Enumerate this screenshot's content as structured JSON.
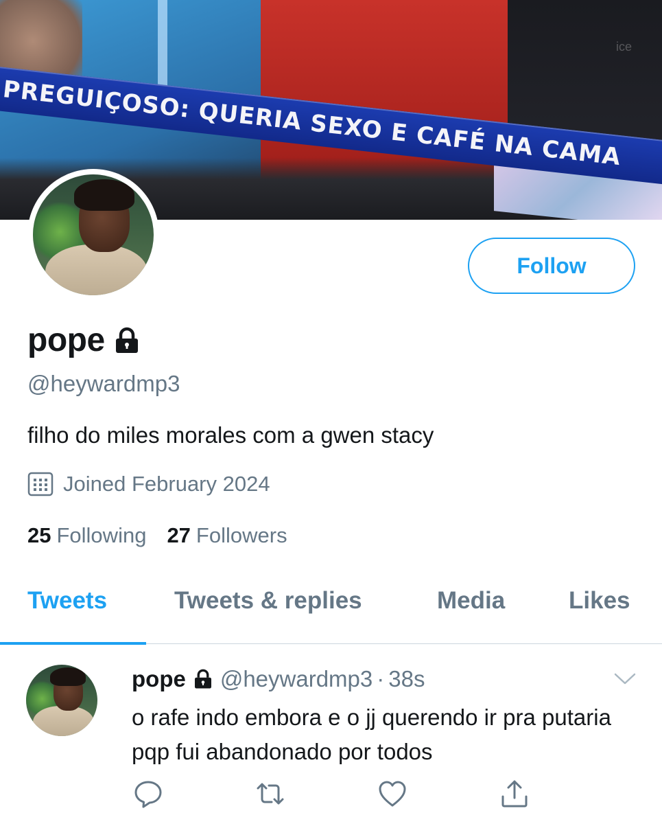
{
  "banner": {
    "ticker_text": "PREGUIÇOSO: QUERIA SEXO E CAFÉ NA CAMA",
    "watermark": "ice"
  },
  "profile": {
    "follow_label": "Follow",
    "name": "pope",
    "handle": "@heywardmp3",
    "bio": "filho do miles morales com a gwen stacy",
    "joined": "Joined February 2024",
    "following_count": "25",
    "following_label": "Following",
    "followers_count": "27",
    "followers_label": "Followers",
    "protected_icon": "lock-icon",
    "joined_icon": "calendar-icon"
  },
  "tabs": [
    {
      "label": "Tweets",
      "active": true
    },
    {
      "label": "Tweets & replies",
      "active": false
    },
    {
      "label": "Media",
      "active": false
    },
    {
      "label": "Likes",
      "active": false
    }
  ],
  "tweet": {
    "name": "pope",
    "handle": "@heywardmp3",
    "separator": "·",
    "time": "38s",
    "text": "o rafe indo embora e o jj querendo ir pra putaria pqp fui abandonado por todos",
    "actions": [
      "reply-icon",
      "retweet-icon",
      "like-icon",
      "share-icon"
    ]
  },
  "colors": {
    "accent": "#1da1f2",
    "secondary_text": "#657786",
    "primary_text": "#14171a",
    "divider": "#ccd6dd"
  }
}
